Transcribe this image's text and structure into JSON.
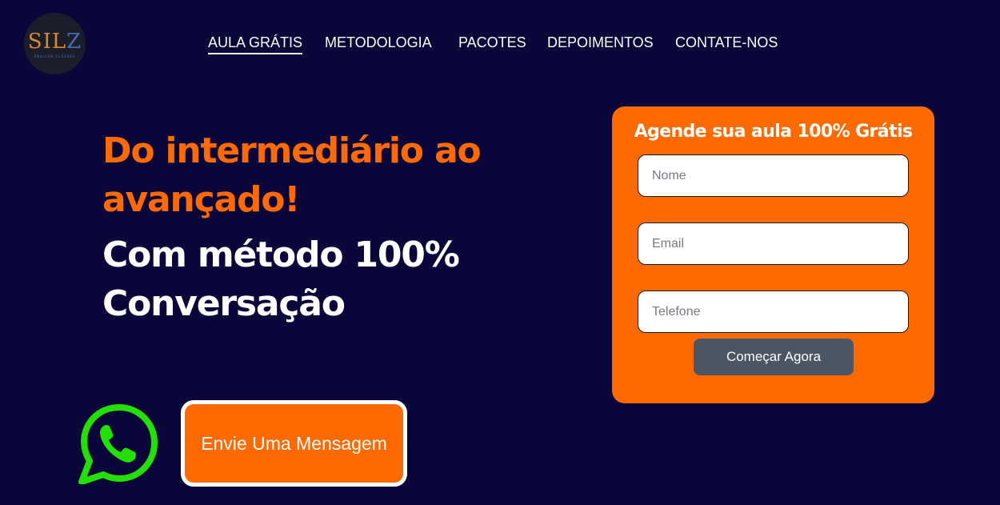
{
  "logo": {
    "mark_left": "SIL",
    "mark_right": "Z",
    "subtitle": "ENGLISH CLASSES"
  },
  "nav": {
    "items": [
      {
        "label": "AULA GRÁTIS"
      },
      {
        "label": "METODOLOGIA"
      },
      {
        "label": "PACOTES"
      },
      {
        "label": "DEPOIMENTOS"
      },
      {
        "label": "CONTATE-NOS"
      }
    ]
  },
  "hero": {
    "headline_orange": "Do intermediário ao avançado!",
    "headline_white": "Com método 100% Conversação"
  },
  "whatsapp": {
    "icon": "whatsapp-icon",
    "button_label": "Envie Uma Mensagem"
  },
  "form": {
    "title": "Agende sua aula 100% Grátis",
    "name_placeholder": "Nome",
    "email_placeholder": "Email",
    "phone_placeholder": "Telefone",
    "submit_label": "Começar Agora"
  },
  "colors": {
    "background": "#0a063a",
    "accent": "#ff6a00",
    "whatsapp_green": "#22e000",
    "button_gray": "#4b5563"
  }
}
